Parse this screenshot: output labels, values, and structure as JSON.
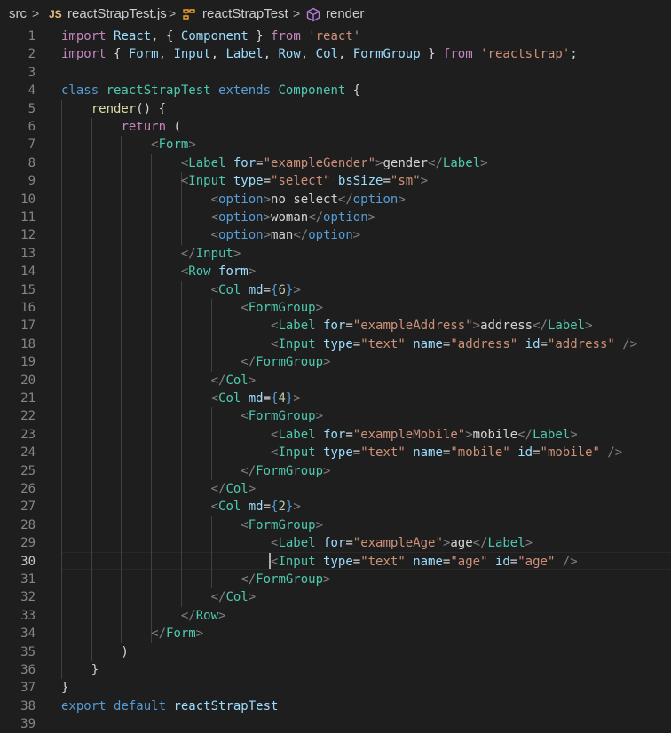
{
  "breadcrumb": {
    "folder": "src",
    "file_badge": "JS",
    "file": "reactStrapTest.js",
    "class_name": "reactStrapTest",
    "method": "render",
    "separator": ">"
  },
  "editor": {
    "line_numbers": [
      "1",
      "2",
      "3",
      "4",
      "5",
      "6",
      "7",
      "8",
      "9",
      "10",
      "11",
      "12",
      "13",
      "14",
      "15",
      "16",
      "17",
      "18",
      "19",
      "20",
      "21",
      "22",
      "23",
      "24",
      "25",
      "26",
      "27",
      "28",
      "29",
      "30",
      "31",
      "32",
      "33",
      "34",
      "35",
      "36",
      "37",
      "38",
      "39"
    ],
    "active_line": "30",
    "lines": [
      [
        [
          "k-imp",
          "import "
        ],
        [
          "id-var",
          "React"
        ],
        [
          "txt",
          ", { "
        ],
        [
          "id-var",
          "Component"
        ],
        [
          "txt",
          " } "
        ],
        [
          "k-imp",
          "from "
        ],
        [
          "str",
          "'react'"
        ]
      ],
      [
        [
          "k-imp",
          "import "
        ],
        [
          "txt",
          "{ "
        ],
        [
          "id-var",
          "Form"
        ],
        [
          "txt",
          ", "
        ],
        [
          "id-var",
          "Input"
        ],
        [
          "txt",
          ", "
        ],
        [
          "id-var",
          "Label"
        ],
        [
          "txt",
          ", "
        ],
        [
          "id-var",
          "Row"
        ],
        [
          "txt",
          ", "
        ],
        [
          "id-var",
          "Col"
        ],
        [
          "txt",
          ", "
        ],
        [
          "id-var",
          "FormGroup"
        ],
        [
          "txt",
          " } "
        ],
        [
          "k-imp",
          "from "
        ],
        [
          "str",
          "'reactstrap'"
        ],
        [
          "txt",
          ";"
        ]
      ],
      [],
      [
        [
          "k-dec",
          "class "
        ],
        [
          "id-cls",
          "reactStrapTest "
        ],
        [
          "k-dec",
          "extends "
        ],
        [
          "id-cls",
          "Component "
        ],
        [
          "txt",
          "{"
        ]
      ],
      [
        [
          "txt",
          "    "
        ],
        [
          "id-fn",
          "render"
        ],
        [
          "txt",
          "() {"
        ]
      ],
      [
        [
          "txt",
          "        "
        ],
        [
          "k-imp",
          "return "
        ],
        [
          "txt",
          "("
        ]
      ],
      [
        [
          "txt",
          "            "
        ],
        [
          "pun",
          "<"
        ],
        [
          "tag",
          "Form"
        ],
        [
          "pun",
          ">"
        ]
      ],
      [
        [
          "txt",
          "                "
        ],
        [
          "pun",
          "<"
        ],
        [
          "tag",
          "Label "
        ],
        [
          "attr",
          "for"
        ],
        [
          "txt",
          "="
        ],
        [
          "str",
          "\"exampleGender\""
        ],
        [
          "pun",
          ">"
        ],
        [
          "txt",
          "gender"
        ],
        [
          "pun",
          "</"
        ],
        [
          "tag",
          "Label"
        ],
        [
          "pun",
          ">"
        ]
      ],
      [
        [
          "txt",
          "                "
        ],
        [
          "pun",
          "<"
        ],
        [
          "tag",
          "Input "
        ],
        [
          "attr",
          "type"
        ],
        [
          "txt",
          "="
        ],
        [
          "str",
          "\"select\" "
        ],
        [
          "attr",
          "bsSize"
        ],
        [
          "txt",
          "="
        ],
        [
          "str",
          "\"sm\""
        ],
        [
          "pun",
          ">"
        ]
      ],
      [
        [
          "txt",
          "                    "
        ],
        [
          "pun",
          "<"
        ],
        [
          "k-dec",
          "option"
        ],
        [
          "pun",
          ">"
        ],
        [
          "txt",
          "no select"
        ],
        [
          "pun",
          "</"
        ],
        [
          "k-dec",
          "option"
        ],
        [
          "pun",
          ">"
        ]
      ],
      [
        [
          "txt",
          "                    "
        ],
        [
          "pun",
          "<"
        ],
        [
          "k-dec",
          "option"
        ],
        [
          "pun",
          ">"
        ],
        [
          "txt",
          "woman"
        ],
        [
          "pun",
          "</"
        ],
        [
          "k-dec",
          "option"
        ],
        [
          "pun",
          ">"
        ]
      ],
      [
        [
          "txt",
          "                    "
        ],
        [
          "pun",
          "<"
        ],
        [
          "k-dec",
          "option"
        ],
        [
          "pun",
          ">"
        ],
        [
          "txt",
          "man"
        ],
        [
          "pun",
          "</"
        ],
        [
          "k-dec",
          "option"
        ],
        [
          "pun",
          ">"
        ]
      ],
      [
        [
          "txt",
          "                "
        ],
        [
          "pun",
          "</"
        ],
        [
          "tag",
          "Input"
        ],
        [
          "pun",
          ">"
        ]
      ],
      [
        [
          "txt",
          "                "
        ],
        [
          "pun",
          "<"
        ],
        [
          "tag",
          "Row "
        ],
        [
          "attr",
          "form"
        ],
        [
          "pun",
          ">"
        ]
      ],
      [
        [
          "txt",
          "                    "
        ],
        [
          "pun",
          "<"
        ],
        [
          "tag",
          "Col "
        ],
        [
          "attr",
          "md"
        ],
        [
          "txt",
          "="
        ],
        [
          "k-dec",
          "{"
        ],
        [
          "num",
          "6"
        ],
        [
          "k-dec",
          "}"
        ],
        [
          "pun",
          ">"
        ]
      ],
      [
        [
          "txt",
          "                        "
        ],
        [
          "pun",
          "<"
        ],
        [
          "tag",
          "FormGroup"
        ],
        [
          "pun",
          ">"
        ]
      ],
      [
        [
          "txt",
          "                            "
        ],
        [
          "pun",
          "<"
        ],
        [
          "tag",
          "Label "
        ],
        [
          "attr",
          "for"
        ],
        [
          "txt",
          "="
        ],
        [
          "str",
          "\"exampleAddress\""
        ],
        [
          "pun",
          ">"
        ],
        [
          "txt",
          "address"
        ],
        [
          "pun",
          "</"
        ],
        [
          "tag",
          "Label"
        ],
        [
          "pun",
          ">"
        ]
      ],
      [
        [
          "txt",
          "                            "
        ],
        [
          "pun",
          "<"
        ],
        [
          "tag",
          "Input "
        ],
        [
          "attr",
          "type"
        ],
        [
          "txt",
          "="
        ],
        [
          "str",
          "\"text\" "
        ],
        [
          "attr",
          "name"
        ],
        [
          "txt",
          "="
        ],
        [
          "str",
          "\"address\" "
        ],
        [
          "attr",
          "id"
        ],
        [
          "txt",
          "="
        ],
        [
          "str",
          "\"address\" "
        ],
        [
          "pun",
          "/>"
        ]
      ],
      [
        [
          "txt",
          "                        "
        ],
        [
          "pun",
          "</"
        ],
        [
          "tag",
          "FormGroup"
        ],
        [
          "pun",
          ">"
        ]
      ],
      [
        [
          "txt",
          "                    "
        ],
        [
          "pun",
          "</"
        ],
        [
          "tag",
          "Col"
        ],
        [
          "pun",
          ">"
        ]
      ],
      [
        [
          "txt",
          "                    "
        ],
        [
          "pun",
          "<"
        ],
        [
          "tag",
          "Col "
        ],
        [
          "attr",
          "md"
        ],
        [
          "txt",
          "="
        ],
        [
          "k-dec",
          "{"
        ],
        [
          "num",
          "4"
        ],
        [
          "k-dec",
          "}"
        ],
        [
          "pun",
          ">"
        ]
      ],
      [
        [
          "txt",
          "                        "
        ],
        [
          "pun",
          "<"
        ],
        [
          "tag",
          "FormGroup"
        ],
        [
          "pun",
          ">"
        ]
      ],
      [
        [
          "txt",
          "                            "
        ],
        [
          "pun",
          "<"
        ],
        [
          "tag",
          "Label "
        ],
        [
          "attr",
          "for"
        ],
        [
          "txt",
          "="
        ],
        [
          "str",
          "\"exampleMobile\""
        ],
        [
          "pun",
          ">"
        ],
        [
          "txt",
          "mobile"
        ],
        [
          "pun",
          "</"
        ],
        [
          "tag",
          "Label"
        ],
        [
          "pun",
          ">"
        ]
      ],
      [
        [
          "txt",
          "                            "
        ],
        [
          "pun",
          "<"
        ],
        [
          "tag",
          "Input "
        ],
        [
          "attr",
          "type"
        ],
        [
          "txt",
          "="
        ],
        [
          "str",
          "\"text\" "
        ],
        [
          "attr",
          "name"
        ],
        [
          "txt",
          "="
        ],
        [
          "str",
          "\"mobile\" "
        ],
        [
          "attr",
          "id"
        ],
        [
          "txt",
          "="
        ],
        [
          "str",
          "\"mobile\" "
        ],
        [
          "pun",
          "/>"
        ]
      ],
      [
        [
          "txt",
          "                        "
        ],
        [
          "pun",
          "</"
        ],
        [
          "tag",
          "FormGroup"
        ],
        [
          "pun",
          ">"
        ]
      ],
      [
        [
          "txt",
          "                    "
        ],
        [
          "pun",
          "</"
        ],
        [
          "tag",
          "Col"
        ],
        [
          "pun",
          ">"
        ]
      ],
      [
        [
          "txt",
          "                    "
        ],
        [
          "pun",
          "<"
        ],
        [
          "tag",
          "Col "
        ],
        [
          "attr",
          "md"
        ],
        [
          "txt",
          "="
        ],
        [
          "k-dec",
          "{"
        ],
        [
          "num",
          "2"
        ],
        [
          "k-dec",
          "}"
        ],
        [
          "pun",
          ">"
        ]
      ],
      [
        [
          "txt",
          "                        "
        ],
        [
          "pun",
          "<"
        ],
        [
          "tag",
          "FormGroup"
        ],
        [
          "pun",
          ">"
        ]
      ],
      [
        [
          "txt",
          "                            "
        ],
        [
          "pun",
          "<"
        ],
        [
          "tag",
          "Label "
        ],
        [
          "attr",
          "for"
        ],
        [
          "txt",
          "="
        ],
        [
          "str",
          "\"exampleAge\""
        ],
        [
          "pun",
          ">"
        ],
        [
          "txt",
          "age"
        ],
        [
          "pun",
          "</"
        ],
        [
          "tag",
          "Label"
        ],
        [
          "pun",
          ">"
        ]
      ],
      [
        [
          "txt",
          "                            "
        ],
        [
          "pun",
          "<"
        ],
        [
          "tag",
          "Input "
        ],
        [
          "attr",
          "type"
        ],
        [
          "txt",
          "="
        ],
        [
          "str",
          "\"text\" "
        ],
        [
          "attr",
          "name"
        ],
        [
          "txt",
          "="
        ],
        [
          "str",
          "\"age\" "
        ],
        [
          "attr",
          "id"
        ],
        [
          "txt",
          "="
        ],
        [
          "str",
          "\"age\" "
        ],
        [
          "pun",
          "/>"
        ]
      ],
      [
        [
          "txt",
          "                        "
        ],
        [
          "pun",
          "</"
        ],
        [
          "tag",
          "FormGroup"
        ],
        [
          "pun",
          ">"
        ]
      ],
      [
        [
          "txt",
          "                    "
        ],
        [
          "pun",
          "</"
        ],
        [
          "tag",
          "Col"
        ],
        [
          "pun",
          ">"
        ]
      ],
      [
        [
          "txt",
          "                "
        ],
        [
          "pun",
          "</"
        ],
        [
          "tag",
          "Row"
        ],
        [
          "pun",
          ">"
        ]
      ],
      [
        [
          "txt",
          "            "
        ],
        [
          "pun",
          "</"
        ],
        [
          "tag",
          "Form"
        ],
        [
          "pun",
          ">"
        ]
      ],
      [
        [
          "txt",
          "        )"
        ]
      ],
      [
        [
          "txt",
          "    }"
        ]
      ],
      [
        [
          "txt",
          "}"
        ]
      ],
      [
        [
          "k-dec",
          "export "
        ],
        [
          "k-dec",
          "default "
        ],
        [
          "id-var",
          "reactStrapTest"
        ]
      ],
      []
    ]
  },
  "colors": {
    "background": "#1e1e1e",
    "line_number": "#858585",
    "keyword_control": "#c586c0",
    "keyword": "#569cd6",
    "type": "#4ec9b0",
    "variable": "#9cdcfe",
    "function": "#dcdcaa",
    "string": "#ce9178",
    "number": "#b5cea8"
  },
  "icons": {
    "class_icon": "symbol-class-icon",
    "method_icon": "symbol-method-icon"
  }
}
